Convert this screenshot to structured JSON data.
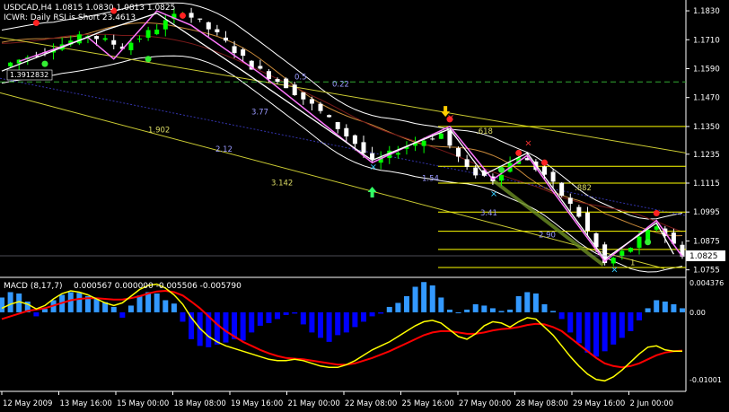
{
  "header": {
    "symbol_line": "USDCAD,H4  1.0815 1.0830 1.0813 1.0825",
    "indicator_line": "ICWR: Daily RSI is Short 23.4613"
  },
  "price_marker": "1.0825",
  "side_tag": "1.3912832",
  "fib_labels": [
    ".618",
    ".882",
    "1.54",
    "2.12",
    "3.41",
    "2.90",
    "1.902",
    "3.142",
    "3.77",
    "0.5",
    "0.22",
    "1"
  ],
  "macd": {
    "label": "MACD (8,17,7)",
    "values_text": "0.000567 0.000000 -0.005506 -0.005790"
  },
  "colors": {
    "background": "#000000",
    "price_up": "#00ff00",
    "price_down": "#ffffff",
    "zigzag": "#ff77ff",
    "zigzag_white": "#ffffff",
    "macd_signal": "#ff0000",
    "macd_main": "#ffff00",
    "hist_up": "#3399ff",
    "hist_down": "#0000ff",
    "fib": "#ffff00"
  },
  "chart_data": [
    {
      "type": "line",
      "title": "USDCAD,H4",
      "description": "4-hour candlestick price chart with zigzag swings, envelope/Bollinger bands and Fibonacci levels",
      "x_labels": [
        "12 May 2009",
        "13 May 16:00",
        "15 May 00:00",
        "18 May 08:00",
        "19 May 16:00",
        "21 May 00:00",
        "22 May 08:00",
        "25 May 16:00",
        "27 May 00:00",
        "28 May 08:00",
        "29 May 16:00",
        "2 Jun 00:00"
      ],
      "y_ticks": [
        "1.1830",
        "1.1710",
        "1.1590",
        "1.1470",
        "1.1350",
        "1.1235",
        "1.1115",
        "1.0995",
        "1.0875",
        "1.0755"
      ],
      "ylim": [
        1.0735,
        1.186
      ],
      "close_path": [
        [
          0,
          1.16
        ],
        [
          6,
          1.168
        ],
        [
          10,
          1.173
        ],
        [
          14,
          1.168
        ],
        [
          18,
          1.176
        ],
        [
          21,
          1.183
        ],
        [
          25,
          1.173
        ],
        [
          29,
          1.16
        ],
        [
          33,
          1.152
        ],
        [
          37,
          1.141
        ],
        [
          41,
          1.128
        ],
        [
          43,
          1.12
        ],
        [
          47,
          1.127
        ],
        [
          51,
          1.132
        ],
        [
          54,
          1.117
        ],
        [
          57,
          1.113
        ],
        [
          60,
          1.123
        ],
        [
          63,
          1.115
        ],
        [
          67,
          1.098
        ],
        [
          70,
          1.078
        ],
        [
          73,
          1.085
        ],
        [
          76,
          1.094
        ],
        [
          79,
          1.082
        ]
      ],
      "zigzag_pink": [
        [
          2,
          1.162
        ],
        [
          10,
          1.172
        ],
        [
          13,
          1.163
        ],
        [
          18,
          1.183
        ],
        [
          22,
          1.177
        ],
        [
          30,
          1.157
        ],
        [
          43,
          1.12
        ],
        [
          52,
          1.135
        ],
        [
          57,
          1.113
        ],
        [
          61,
          1.123
        ],
        [
          64,
          1.108
        ],
        [
          70,
          1.079
        ],
        [
          76,
          1.096
        ],
        [
          79,
          1.081
        ]
      ],
      "fib_levels": [
        1.135,
        1.1185,
        1.1115,
        1.0995,
        1.0915,
        1.084,
        1.0765
      ],
      "current_price": 1.0825
    },
    {
      "type": "bar",
      "title": "MACD (8,17,7)",
      "y_ticks": [
        "0.004376",
        "0.00",
        "-0.01001"
      ],
      "ylim": [
        -0.0115,
        0.0048
      ],
      "histogram": [
        0.0022,
        0.003,
        0.0028,
        0.0016,
        -0.0006,
        0.0005,
        0.0018,
        0.0026,
        0.003,
        0.0029,
        0.0024,
        0.002,
        0.0015,
        0.0008,
        -0.0008,
        0.001,
        0.0025,
        0.003,
        0.0028,
        0.0018,
        0.0013,
        -0.0014,
        -0.004,
        -0.005,
        -0.0052,
        -0.0048,
        -0.0045,
        -0.004,
        -0.0042,
        -0.003,
        -0.002,
        -0.0016,
        -0.001,
        -0.0004,
        -0.0002,
        -0.0018,
        -0.003,
        -0.0038,
        -0.0044,
        -0.0034,
        -0.003,
        -0.0022,
        -0.0014,
        -0.0006,
        -0.0002,
        0.0008,
        0.0014,
        0.0024,
        0.0038,
        0.0045,
        0.004,
        0.0022,
        0.0004,
        0.0,
        0.0004,
        0.0012,
        0.001,
        0.0006,
        0.0002,
        0.0004,
        0.0024,
        0.003,
        0.0028,
        0.0012,
        0.0002,
        -0.001,
        -0.003,
        -0.0046,
        -0.006,
        -0.0066,
        -0.0058,
        -0.0048,
        -0.0038,
        -0.0028,
        -0.0012,
        0.0006,
        0.0018,
        0.0016,
        0.0012,
        0.0006
      ],
      "main_line": [
        0.0006,
        0.0012,
        0.0016,
        0.0012,
        0.0005,
        0.001,
        0.002,
        0.0028,
        0.0032,
        0.003,
        0.0026,
        0.002,
        0.0014,
        0.001,
        0.0014,
        0.0024,
        0.0034,
        0.004,
        0.0042,
        0.0036,
        0.0026,
        0.0012,
        -0.0008,
        -0.0024,
        -0.0036,
        -0.0044,
        -0.005,
        -0.0054,
        -0.0058,
        -0.0062,
        -0.0066,
        -0.007,
        -0.0072,
        -0.0072,
        -0.007,
        -0.0072,
        -0.0076,
        -0.008,
        -0.0082,
        -0.0082,
        -0.0078,
        -0.0072,
        -0.0064,
        -0.0056,
        -0.005,
        -0.0044,
        -0.0036,
        -0.0028,
        -0.002,
        -0.0014,
        -0.0012,
        -0.0016,
        -0.0026,
        -0.0036,
        -0.004,
        -0.0032,
        -0.002,
        -0.0014,
        -0.0016,
        -0.0022,
        -0.0014,
        -0.0008,
        -0.001,
        -0.0022,
        -0.0034,
        -0.005,
        -0.0066,
        -0.008,
        -0.0092,
        -0.01,
        -0.0102,
        -0.0096,
        -0.0086,
        -0.0074,
        -0.0062,
        -0.0052,
        -0.005,
        -0.0056,
        -0.0058,
        -0.0058
      ],
      "signal_line": [
        -0.001,
        -0.0006,
        -0.0002,
        0.0002,
        0.0004,
        0.0006,
        0.001,
        0.0014,
        0.0018,
        0.002,
        0.0021,
        0.0021,
        0.002,
        0.0019,
        0.0019,
        0.0021,
        0.0024,
        0.0028,
        0.0031,
        0.0032,
        0.003,
        0.0025,
        0.0016,
        0.0006,
        -0.0006,
        -0.0018,
        -0.0028,
        -0.0036,
        -0.0044,
        -0.005,
        -0.0056,
        -0.0061,
        -0.0065,
        -0.0068,
        -0.0069,
        -0.007,
        -0.0072,
        -0.0074,
        -0.0076,
        -0.0078,
        -0.0078,
        -0.0076,
        -0.0072,
        -0.0068,
        -0.0063,
        -0.0058,
        -0.0052,
        -0.0046,
        -0.004,
        -0.0034,
        -0.003,
        -0.0028,
        -0.0028,
        -0.003,
        -0.0032,
        -0.0032,
        -0.003,
        -0.0027,
        -0.0025,
        -0.0024,
        -0.0022,
        -0.0019,
        -0.0017,
        -0.0018,
        -0.0022,
        -0.0028,
        -0.0038,
        -0.0048,
        -0.0058,
        -0.0068,
        -0.0076,
        -0.008,
        -0.0082,
        -0.008,
        -0.0076,
        -0.007,
        -0.0064,
        -0.006,
        -0.0058,
        -0.0057
      ]
    }
  ]
}
